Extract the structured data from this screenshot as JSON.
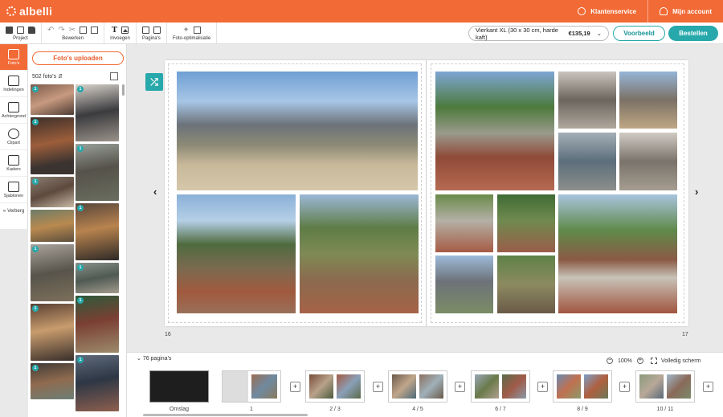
{
  "brand": {
    "name": "albelli",
    "accent": "#f26a35",
    "teal": "#27a8ab"
  },
  "header": {
    "service": "Klantenservice",
    "account": "Mijn account"
  },
  "toolbar": {
    "groups": [
      {
        "label": "Project"
      },
      {
        "label": "Bewerken"
      },
      {
        "label": "Invoegen"
      },
      {
        "label": "Pagina's"
      },
      {
        "label": "Foto-optimalisatie"
      }
    ],
    "product": "Vierkant XL (30 x 30 cm, harde kaft)",
    "price": "€135,19",
    "preview_label": "Voorbeeld",
    "order_label": "Bestellen"
  },
  "leftnav": {
    "items": [
      {
        "label": "Foto's",
        "icon": "photos-icon"
      },
      {
        "label": "Indelingen",
        "icon": "layouts-icon"
      },
      {
        "label": "Achtergrond",
        "icon": "paint-roller-icon"
      },
      {
        "label": "Clipart",
        "icon": "flower-icon"
      },
      {
        "label": "Kaders",
        "icon": "frame-icon"
      },
      {
        "label": "Sjablonen",
        "icon": "star-icon"
      }
    ],
    "hide_label": "Verberg"
  },
  "panel": {
    "upload_label": "Foto's uploaden",
    "count": "502 foto's",
    "badge": "1"
  },
  "spread": {
    "left_page": "16",
    "right_page": "17"
  },
  "filmstrip": {
    "pages_label": "76 pagina's",
    "zoom": "100%",
    "fullscreen": "Volledig scherm",
    "thumbs": [
      "Omslag",
      "1",
      "2 / 3",
      "4 / 5",
      "6 / 7",
      "8 / 9",
      "10 / 11"
    ]
  }
}
